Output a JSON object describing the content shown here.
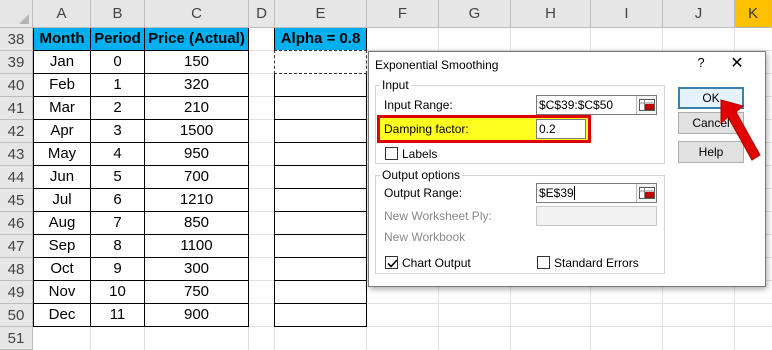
{
  "sheet": {
    "columns": [
      "A",
      "B",
      "C",
      "D",
      "E",
      "F",
      "G",
      "H",
      "I",
      "J",
      "K"
    ],
    "rows": [
      "38",
      "39",
      "40",
      "41",
      "42",
      "43",
      "44",
      "45",
      "46",
      "47",
      "48",
      "49",
      "50",
      "51"
    ],
    "table_headers": {
      "month": "Month",
      "period": "Period",
      "price": "Price (Actual)"
    },
    "alpha_header": "Alpha = 0.8",
    "data": [
      {
        "month": "Jan",
        "period": "0",
        "price": "150"
      },
      {
        "month": "Feb",
        "period": "1",
        "price": "320"
      },
      {
        "month": "Mar",
        "period": "2",
        "price": "210"
      },
      {
        "month": "Apr",
        "period": "3",
        "price": "1500"
      },
      {
        "month": "May",
        "period": "4",
        "price": "950"
      },
      {
        "month": "Jun",
        "period": "5",
        "price": "700"
      },
      {
        "month": "Jul",
        "period": "6",
        "price": "1210"
      },
      {
        "month": "Aug",
        "period": "7",
        "price": "850"
      },
      {
        "month": "Sep",
        "period": "8",
        "price": "1100"
      },
      {
        "month": "Oct",
        "period": "9",
        "price": "300"
      },
      {
        "month": "Nov",
        "period": "10",
        "price": "750"
      },
      {
        "month": "Dec",
        "period": "11",
        "price": "900"
      }
    ],
    "colors": {
      "header_fill": "#00b0f0",
      "column_header_selected": "#ffc000"
    }
  },
  "dialog": {
    "title": "Exponential Smoothing",
    "help_glyph": "?",
    "close_glyph": "✕",
    "input_group_label": "Input",
    "input_range_label": "Input Range:",
    "input_range_value": "$C$39:$C$50",
    "damping_label": "Damping factor:",
    "damping_value": "0.2",
    "labels_checkbox": "Labels",
    "labels_checked": false,
    "output_group_label": "Output options",
    "output_range_label": "Output Range:",
    "output_range_value": "$E$39",
    "new_ply_label": "New Worksheet Ply:",
    "new_workbook_label": "New Workbook",
    "chart_output_label": "Chart Output",
    "chart_output_checked": true,
    "standard_errors_label": "Standard Errors",
    "standard_errors_checked": false,
    "buttons": {
      "ok": "OK",
      "cancel": "Cancel",
      "help": "Help"
    },
    "colors": {
      "highlight_border": "#e00000",
      "highlight_fill": "#ffff1e",
      "arrow": "#e00000"
    }
  }
}
